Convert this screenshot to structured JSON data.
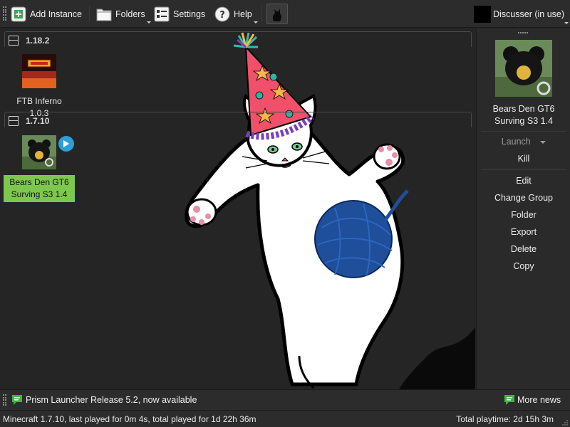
{
  "toolbar": {
    "add_instance": "Add Instance",
    "folders": "Folders",
    "settings": "Settings",
    "help": "Help",
    "account": "Discusser (in use)"
  },
  "groups": [
    {
      "title": "1.18.2",
      "instances": [
        {
          "name": "FTB Inferno 1.0.3",
          "icon": "ftb-inferno-logo"
        }
      ]
    },
    {
      "title": "1.7.10",
      "instances": [
        {
          "name": "Bears Den GT6 Surving S3 1.4",
          "icon": "bear-head-icon",
          "selected": true,
          "running": true
        }
      ]
    }
  ],
  "side_panel": {
    "instance_name": "Bears Den GT6 Surving S3 1.4",
    "launch": "Launch",
    "kill": "Kill",
    "edit": "Edit",
    "change_group": "Change Group",
    "folder": "Folder",
    "export": "Export",
    "delete": "Delete",
    "copy": "Copy"
  },
  "news": {
    "headline": "Prism Launcher Release 5.2, now available",
    "more": "More news"
  },
  "status": {
    "left": "Minecraft 1.7.10, last played for 0m 4s, total played for 1d 22h 36m",
    "right": "Total playtime: 2d 15h 3m"
  },
  "colors": {
    "accent_green": "#7ec74e",
    "background": "#252525",
    "cat_hat": "#f0506a",
    "yarn": "#1f4e9a"
  }
}
